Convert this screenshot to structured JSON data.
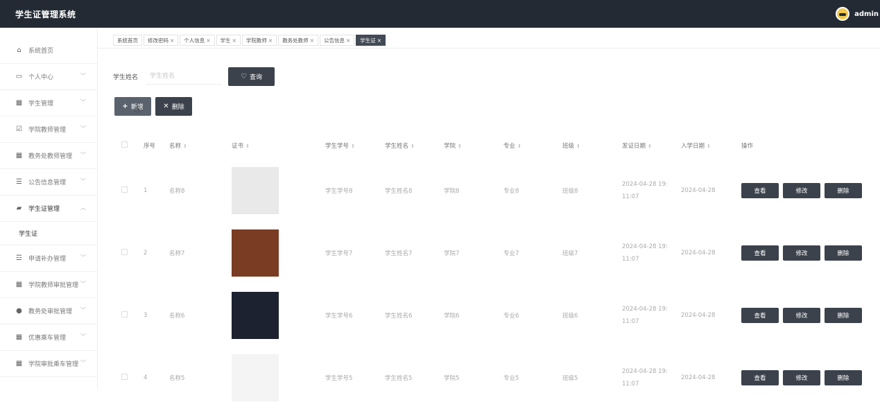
{
  "header": {
    "title": "学生证管理系统",
    "username": "admin"
  },
  "sidebar": {
    "items": [
      {
        "label": "系统首页",
        "icon": "home-icon"
      },
      {
        "label": "个人中心",
        "icon": "calendar-icon"
      },
      {
        "label": "学生管理",
        "icon": "grid-icon"
      },
      {
        "label": "学院教师管理",
        "icon": "check-square-icon"
      },
      {
        "label": "教务处教师管理",
        "icon": "grid-icon"
      },
      {
        "label": "公告信息管理",
        "icon": "list-icon"
      },
      {
        "label": "学生证管理",
        "icon": "thumbs-up-icon"
      },
      {
        "label": "申请补办管理",
        "icon": "sliders-icon"
      },
      {
        "label": "学院教师审批管理",
        "icon": "grid-icon"
      },
      {
        "label": "教务处审批管理",
        "icon": "location-icon"
      },
      {
        "label": "优惠乘车管理",
        "icon": "grid-icon"
      },
      {
        "label": "学院审批乘车管理",
        "icon": "apps-icon"
      }
    ],
    "submenu": {
      "label": "学生证"
    }
  },
  "tabs": [
    {
      "label": "系统首页",
      "closable": false
    },
    {
      "label": "修改密码",
      "closable": true
    },
    {
      "label": "个人信息",
      "closable": true
    },
    {
      "label": "学生",
      "closable": true
    },
    {
      "label": "学院教师",
      "closable": true
    },
    {
      "label": "教务处教师",
      "closable": true
    },
    {
      "label": "公告信息",
      "closable": true
    },
    {
      "label": "学生证",
      "closable": true,
      "active": true
    }
  ],
  "search": {
    "label": "学生姓名",
    "placeholder": "学生姓名",
    "button": "查询"
  },
  "toolbar": {
    "add_label": "新增",
    "delete_label": "删除"
  },
  "table": {
    "columns": [
      "序号",
      "名称",
      "证书",
      "学生学号",
      "学生姓名",
      "学院",
      "专业",
      "班级",
      "发证日期",
      "入学日期",
      "操作"
    ],
    "rows": [
      {
        "index": "1",
        "name": "名称8",
        "student_no": "学生学号8",
        "student_name": "学生姓名8",
        "college": "学院8",
        "major": "专业8",
        "class": "班级8",
        "issue_date_1": "2024-04-28 19:",
        "issue_date_2": "11:07",
        "enroll_date": "2024-04-28"
      },
      {
        "index": "2",
        "name": "名称7",
        "student_no": "学生学号7",
        "student_name": "学生姓名7",
        "college": "学院7",
        "major": "专业7",
        "class": "班级7",
        "issue_date_1": "2024-04-28 19:",
        "issue_date_2": "11:07",
        "enroll_date": "2024-04-28"
      },
      {
        "index": "3",
        "name": "名称6",
        "student_no": "学生学号6",
        "student_name": "学生姓名6",
        "college": "学院6",
        "major": "专业6",
        "class": "班级6",
        "issue_date_1": "2024-04-28 19:",
        "issue_date_2": "11:07",
        "enroll_date": "2024-04-28"
      },
      {
        "index": "4",
        "name": "名称5",
        "student_no": "学生学号5",
        "student_name": "学生姓名5",
        "college": "学院5",
        "major": "专业5",
        "class": "班级5",
        "issue_date_1": "2024-04-28 19:",
        "issue_date_2": "11:07",
        "enroll_date": "2024-04-28"
      }
    ],
    "actions": {
      "view": "查看",
      "edit": "修改",
      "delete": "删除"
    }
  },
  "colors": {
    "topbar": "#232a33",
    "button": "#3b424c",
    "active_tab": "#424a55"
  }
}
